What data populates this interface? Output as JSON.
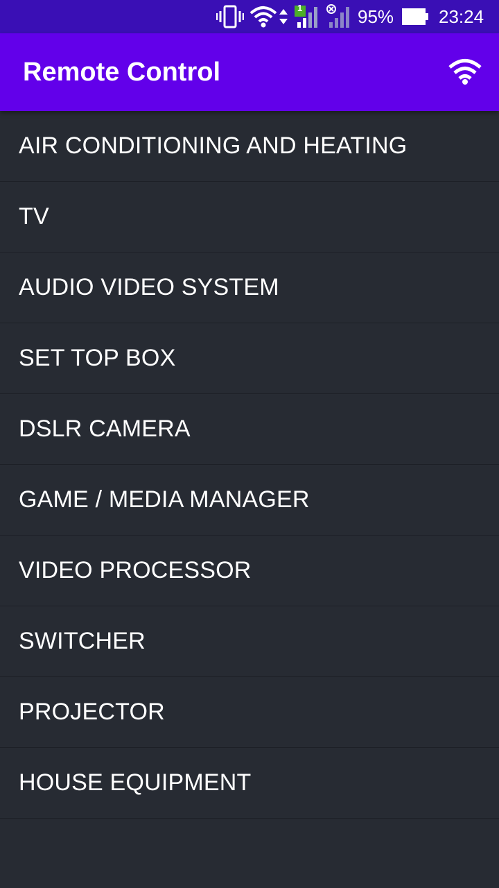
{
  "status_bar": {
    "battery_percent": "95%",
    "time": "23:24",
    "sim_slot_label": "1",
    "icons": [
      "vibrate-icon",
      "wifi-icon",
      "data-arrows-icon",
      "signal-icon",
      "no-signal-icon",
      "battery-icon"
    ],
    "background_color": "#3a0fb5"
  },
  "app_bar": {
    "title": "Remote Control",
    "action_icon": "wifi-icon",
    "background_color": "#6200ea"
  },
  "device_list": {
    "background_color": "#272b33",
    "items": [
      {
        "label": "AIR CONDITIONING AND HEATING"
      },
      {
        "label": "TV"
      },
      {
        "label": "AUDIO VIDEO SYSTEM"
      },
      {
        "label": "SET TOP BOX"
      },
      {
        "label": "DSLR CAMERA"
      },
      {
        "label": "GAME / MEDIA MANAGER"
      },
      {
        "label": "VIDEO PROCESSOR"
      },
      {
        "label": "SWITCHER"
      },
      {
        "label": "PROJECTOR"
      },
      {
        "label": "HOUSE EQUIPMENT"
      }
    ]
  }
}
